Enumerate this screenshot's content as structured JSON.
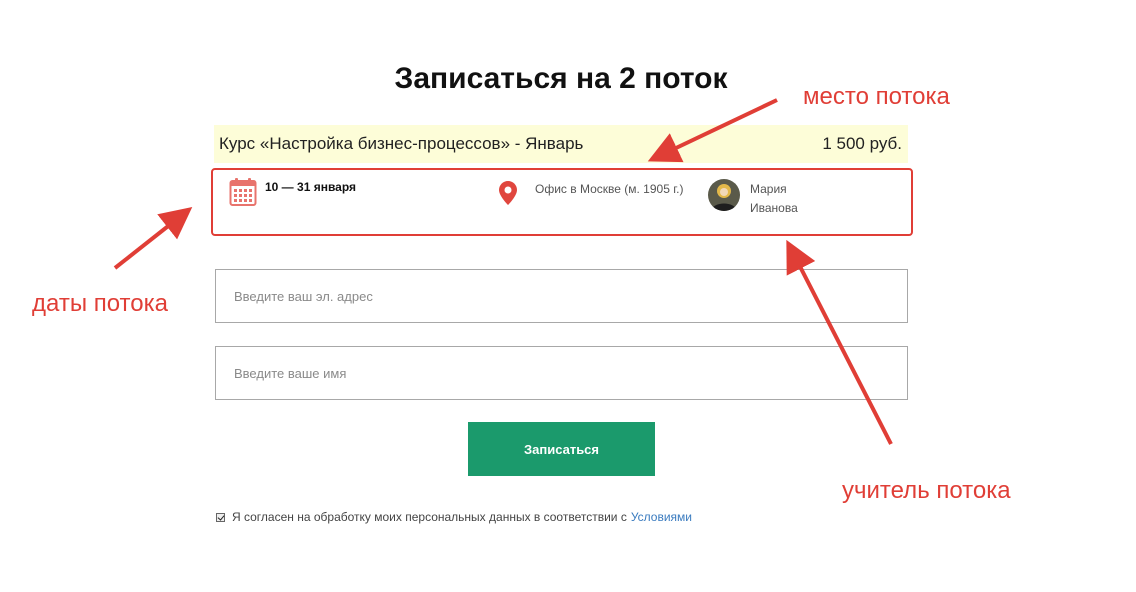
{
  "title": "Записаться на 2 поток",
  "course": {
    "name": "Курс «Настройка бизнес-процессов» - Январь",
    "price": "1 500 руб."
  },
  "details": {
    "dates": "10 — 31 января",
    "location": "Офис в Москве (м. 1905 г.)",
    "teacher": "Мария Иванова",
    "icons": [
      "calendar-icon",
      "map-pin-icon",
      "teacher-avatar"
    ]
  },
  "form": {
    "email_placeholder": "Введите ваш эл. адрес",
    "name_placeholder": "Введите ваше имя",
    "submit_label": "Записаться"
  },
  "consent": {
    "text": "Я согласен на обработку моих персональных данных в соответствии с",
    "link": "Условиями",
    "checked": true
  },
  "annotations": {
    "dates": "даты потока",
    "place": "место потока",
    "teacher": "учитель потока"
  },
  "colors": {
    "accent_red": "#e03e36",
    "button_green": "#1b9a6c",
    "course_bar_bg": "#fdfdd8",
    "link_blue": "#3a7bbf"
  }
}
